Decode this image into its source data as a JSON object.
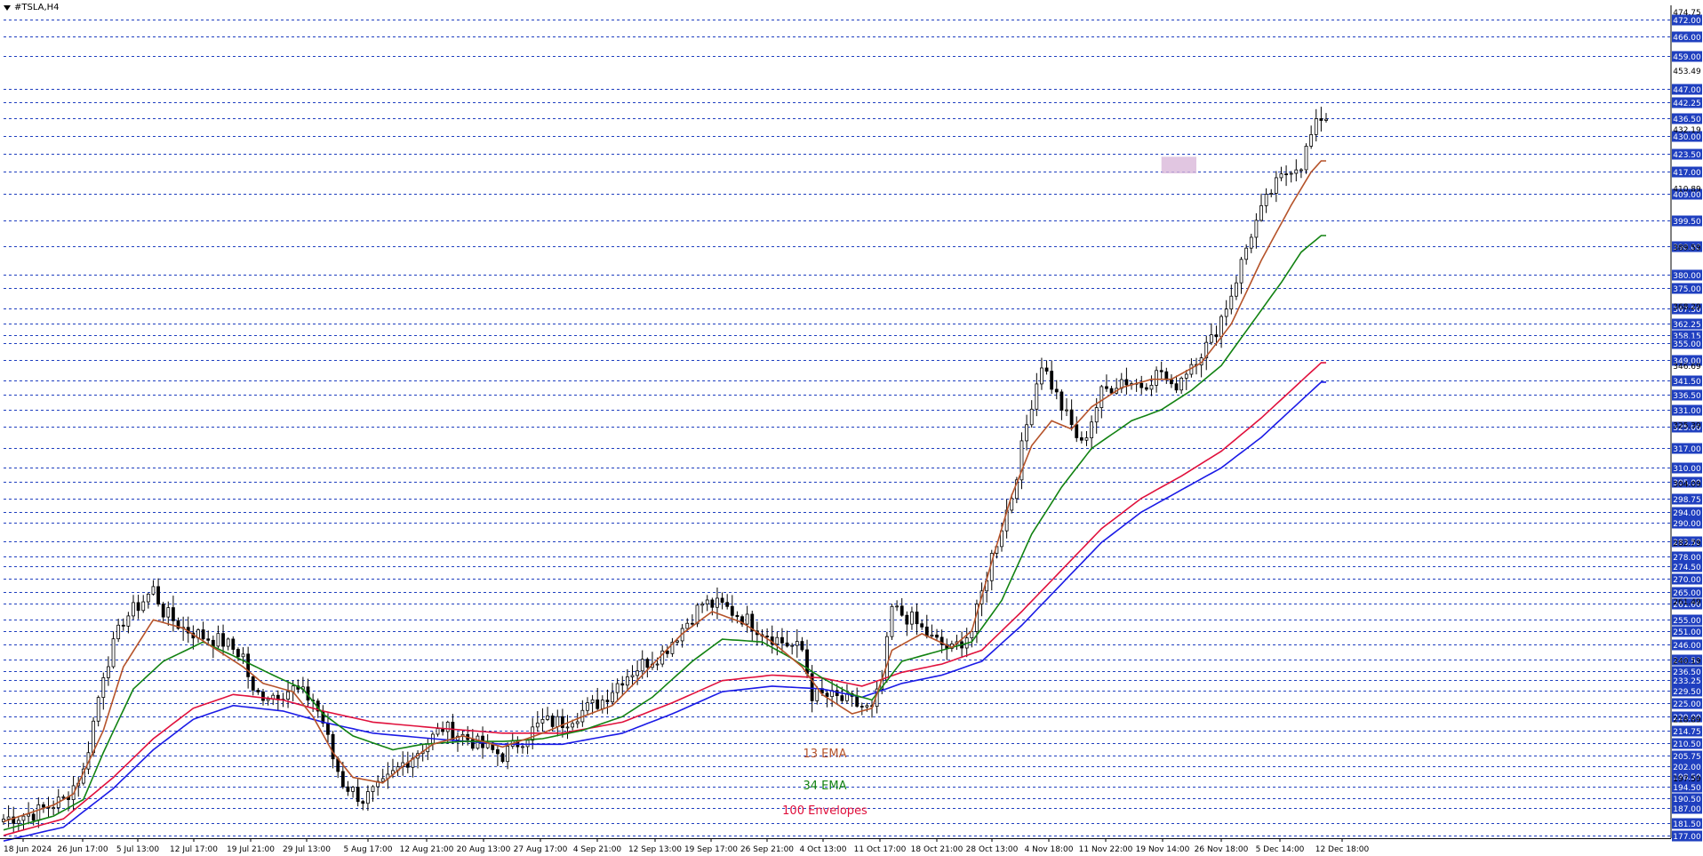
{
  "window": {
    "symbol_title": "#TSLA,H4"
  },
  "colors": {
    "grid": "#1f3fbf",
    "candle": "#000000",
    "ema13": "#b5532a",
    "ema34": "#128212",
    "env_upper": "#e0103c",
    "env_lower": "#1a1ae6",
    "zone": "#d9b8da",
    "price_tag_bg": "#1f3fbf"
  },
  "chart_data": {
    "type": "candlestick",
    "symbol": "#TSLA",
    "timeframe": "H4",
    "ylim": [
      176,
      476
    ],
    "x_tick_labels": [
      "18 Jun 2024",
      "26 Jun 17:00",
      "5 Jul 13:00",
      "12 Jul 17:00",
      "19 Jul 21:00",
      "29 Jul 13:00",
      "5 Aug 17:00",
      "12 Aug 21:00",
      "20 Aug 13:00",
      "27 Aug 17:00",
      "4 Sep 21:00",
      "12 Sep 13:00",
      "19 Sep 17:00",
      "26 Sep 21:00",
      "4 Oct 13:00",
      "11 Oct 17:00",
      "18 Oct 21:00",
      "28 Oct 13:00",
      "4 Nov 18:00",
      "11 Nov 22:00",
      "19 Nov 14:00",
      "26 Nov 18:00",
      "5 Dec 14:00",
      "12 Dec 18:00"
    ],
    "price_level_tags": [
      "472.00",
      "466.00",
      "459.00",
      "447.00",
      "442.25",
      "436.50",
      "430.00",
      "423.50",
      "417.00",
      "409.00",
      "399.50",
      "390.00",
      "380.00",
      "375.00",
      "367.50",
      "362.25",
      "358.15",
      "355.00",
      "349.00",
      "341.50",
      "336.50",
      "331.00",
      "325.00",
      "317.00",
      "310.00",
      "305.00",
      "298.75",
      "294.00",
      "290.00",
      "283.50",
      "278.00",
      "274.50",
      "270.00",
      "265.00",
      "261.00",
      "255.00",
      "251.00",
      "246.00",
      "240.50",
      "236.50",
      "233.25",
      "229.50",
      "225.00",
      "220.00",
      "214.75",
      "210.50",
      "205.75",
      "202.00",
      "198.50",
      "194.50",
      "190.50",
      "187.00",
      "181.50",
      "177.00"
    ],
    "axis_plain_labels": [
      "474.75",
      "453.49",
      "432.19",
      "410.89",
      "389.59",
      "368.29",
      "346.69",
      "325.39",
      "304.09",
      "282.79",
      "261.49",
      "240.19",
      "218.89",
      "197.59"
    ],
    "annotations": {
      "ema13": "13 EMA",
      "ema34": "34 EMA",
      "envelopes": "100 Envelopes"
    },
    "zone_box": {
      "x_from": 232,
      "x_to": 239,
      "y_from": 416.5,
      "y_to": 422.5
    },
    "series": [
      {
        "key": "candles",
        "type": "candlestick"
      },
      {
        "key": "ema13",
        "name": "13 EMA",
        "type": "line"
      },
      {
        "key": "ema34",
        "name": "34 EMA",
        "type": "line"
      },
      {
        "key": "env_upper",
        "name": "100 Envelopes",
        "type": "line"
      },
      {
        "key": "env_lower",
        "name": "100 Envelopes",
        "type": "line"
      }
    ],
    "price_anchors": [
      [
        0,
        183
      ],
      [
        6,
        185
      ],
      [
        12,
        190
      ],
      [
        16,
        200
      ],
      [
        20,
        236
      ],
      [
        24,
        255
      ],
      [
        28,
        262
      ],
      [
        30,
        266
      ],
      [
        32,
        258
      ],
      [
        36,
        252
      ],
      [
        40,
        249
      ],
      [
        44,
        247
      ],
      [
        48,
        242
      ],
      [
        50,
        228
      ],
      [
        54,
        228
      ],
      [
        58,
        230
      ],
      [
        62,
        226
      ],
      [
        64,
        218
      ],
      [
        66,
        205
      ],
      [
        68,
        196
      ],
      [
        72,
        190
      ],
      [
        76,
        195
      ],
      [
        80,
        203
      ],
      [
        84,
        209
      ],
      [
        88,
        216
      ],
      [
        92,
        213
      ],
      [
        96,
        209
      ],
      [
        100,
        206
      ],
      [
        104,
        212
      ],
      [
        108,
        218
      ],
      [
        112,
        218
      ],
      [
        116,
        222
      ],
      [
        120,
        226
      ],
      [
        124,
        234
      ],
      [
        128,
        239
      ],
      [
        132,
        243
      ],
      [
        136,
        252
      ],
      [
        140,
        261
      ],
      [
        144,
        260
      ],
      [
        148,
        256
      ],
      [
        152,
        251
      ],
      [
        156,
        247
      ],
      [
        160,
        244
      ],
      [
        162,
        228
      ],
      [
        166,
        227
      ],
      [
        170,
        225
      ],
      [
        174,
        222
      ],
      [
        176,
        233
      ],
      [
        178,
        259
      ],
      [
        182,
        255
      ],
      [
        186,
        248
      ],
      [
        190,
        244
      ],
      [
        194,
        251
      ],
      [
        198,
        278
      ],
      [
        202,
        300
      ],
      [
        206,
        334
      ],
      [
        208,
        348
      ],
      [
        212,
        332
      ],
      [
        216,
        318
      ],
      [
        220,
        337
      ],
      [
        224,
        342
      ],
      [
        228,
        340
      ],
      [
        232,
        345
      ],
      [
        234,
        338
      ],
      [
        238,
        348
      ],
      [
        242,
        356
      ],
      [
        246,
        373
      ],
      [
        250,
        395
      ],
      [
        254,
        410
      ],
      [
        258,
        419
      ],
      [
        260,
        420
      ],
      [
        262,
        430
      ],
      [
        264,
        437
      ]
    ],
    "ema13_anchors": [
      [
        0,
        182
      ],
      [
        10,
        188
      ],
      [
        14,
        192
      ],
      [
        20,
        215
      ],
      [
        24,
        238
      ],
      [
        30,
        255
      ],
      [
        36,
        252
      ],
      [
        42,
        245
      ],
      [
        48,
        238
      ],
      [
        52,
        232
      ],
      [
        58,
        229
      ],
      [
        62,
        220
      ],
      [
        66,
        207
      ],
      [
        70,
        198
      ],
      [
        76,
        196
      ],
      [
        80,
        202
      ],
      [
        86,
        210
      ],
      [
        92,
        213
      ],
      [
        100,
        209
      ],
      [
        108,
        214
      ],
      [
        116,
        220
      ],
      [
        122,
        224
      ],
      [
        128,
        235
      ],
      [
        136,
        250
      ],
      [
        142,
        258
      ],
      [
        148,
        254
      ],
      [
        154,
        247
      ],
      [
        160,
        238
      ],
      [
        164,
        228
      ],
      [
        170,
        221
      ],
      [
        174,
        223
      ],
      [
        178,
        244
      ],
      [
        184,
        250
      ],
      [
        190,
        245
      ],
      [
        194,
        251
      ],
      [
        198,
        276
      ],
      [
        202,
        300
      ],
      [
        206,
        318
      ],
      [
        210,
        327
      ],
      [
        214,
        324
      ],
      [
        218,
        332
      ],
      [
        224,
        339
      ],
      [
        230,
        342
      ],
      [
        234,
        342
      ],
      [
        240,
        348
      ],
      [
        246,
        362
      ],
      [
        252,
        385
      ],
      [
        258,
        405
      ],
      [
        262,
        417
      ],
      [
        264,
        421
      ]
    ],
    "ema34_anchors": [
      [
        0,
        179
      ],
      [
        10,
        184
      ],
      [
        16,
        190
      ],
      [
        20,
        207
      ],
      [
        26,
        230
      ],
      [
        32,
        240
      ],
      [
        40,
        247
      ],
      [
        46,
        242
      ],
      [
        54,
        235
      ],
      [
        60,
        230
      ],
      [
        64,
        221
      ],
      [
        70,
        213
      ],
      [
        78,
        208
      ],
      [
        84,
        210
      ],
      [
        92,
        211
      ],
      [
        100,
        211
      ],
      [
        108,
        212
      ],
      [
        116,
        215
      ],
      [
        124,
        220
      ],
      [
        130,
        227
      ],
      [
        138,
        240
      ],
      [
        144,
        248
      ],
      [
        152,
        247
      ],
      [
        158,
        241
      ],
      [
        164,
        234
      ],
      [
        170,
        228
      ],
      [
        174,
        226
      ],
      [
        180,
        240
      ],
      [
        188,
        244
      ],
      [
        194,
        247
      ],
      [
        200,
        262
      ],
      [
        206,
        286
      ],
      [
        212,
        303
      ],
      [
        218,
        317
      ],
      [
        226,
        327
      ],
      [
        232,
        331
      ],
      [
        238,
        338
      ],
      [
        244,
        347
      ],
      [
        250,
        362
      ],
      [
        256,
        377
      ],
      [
        260,
        388
      ],
      [
        264,
        394
      ]
    ],
    "env_upper_anchors": [
      [
        0,
        177
      ],
      [
        12,
        183
      ],
      [
        22,
        198
      ],
      [
        30,
        212
      ],
      [
        38,
        223
      ],
      [
        46,
        228
      ],
      [
        56,
        226
      ],
      [
        64,
        222
      ],
      [
        74,
        218
      ],
      [
        86,
        216
      ],
      [
        100,
        214
      ],
      [
        112,
        214
      ],
      [
        124,
        218
      ],
      [
        134,
        225
      ],
      [
        144,
        233
      ],
      [
        154,
        235
      ],
      [
        164,
        234
      ],
      [
        172,
        231
      ],
      [
        180,
        236
      ],
      [
        188,
        239
      ],
      [
        196,
        244
      ],
      [
        204,
        258
      ],
      [
        212,
        273
      ],
      [
        220,
        288
      ],
      [
        228,
        299
      ],
      [
        236,
        307
      ],
      [
        244,
        316
      ],
      [
        252,
        328
      ],
      [
        258,
        338
      ],
      [
        264,
        348
      ]
    ],
    "env_lower_anchors": [
      [
        0,
        175
      ],
      [
        12,
        180
      ],
      [
        22,
        194
      ],
      [
        30,
        208
      ],
      [
        38,
        219
      ],
      [
        46,
        224
      ],
      [
        56,
        222
      ],
      [
        64,
        218
      ],
      [
        74,
        214
      ],
      [
        86,
        212
      ],
      [
        100,
        210
      ],
      [
        112,
        210
      ],
      [
        124,
        214
      ],
      [
        134,
        221
      ],
      [
        144,
        229
      ],
      [
        154,
        231
      ],
      [
        164,
        230
      ],
      [
        172,
        227
      ],
      [
        180,
        232
      ],
      [
        188,
        235
      ],
      [
        196,
        240
      ],
      [
        204,
        253
      ],
      [
        212,
        268
      ],
      [
        220,
        283
      ],
      [
        228,
        294
      ],
      [
        236,
        302
      ],
      [
        244,
        310
      ],
      [
        252,
        321
      ],
      [
        258,
        331
      ],
      [
        264,
        341
      ]
    ]
  }
}
